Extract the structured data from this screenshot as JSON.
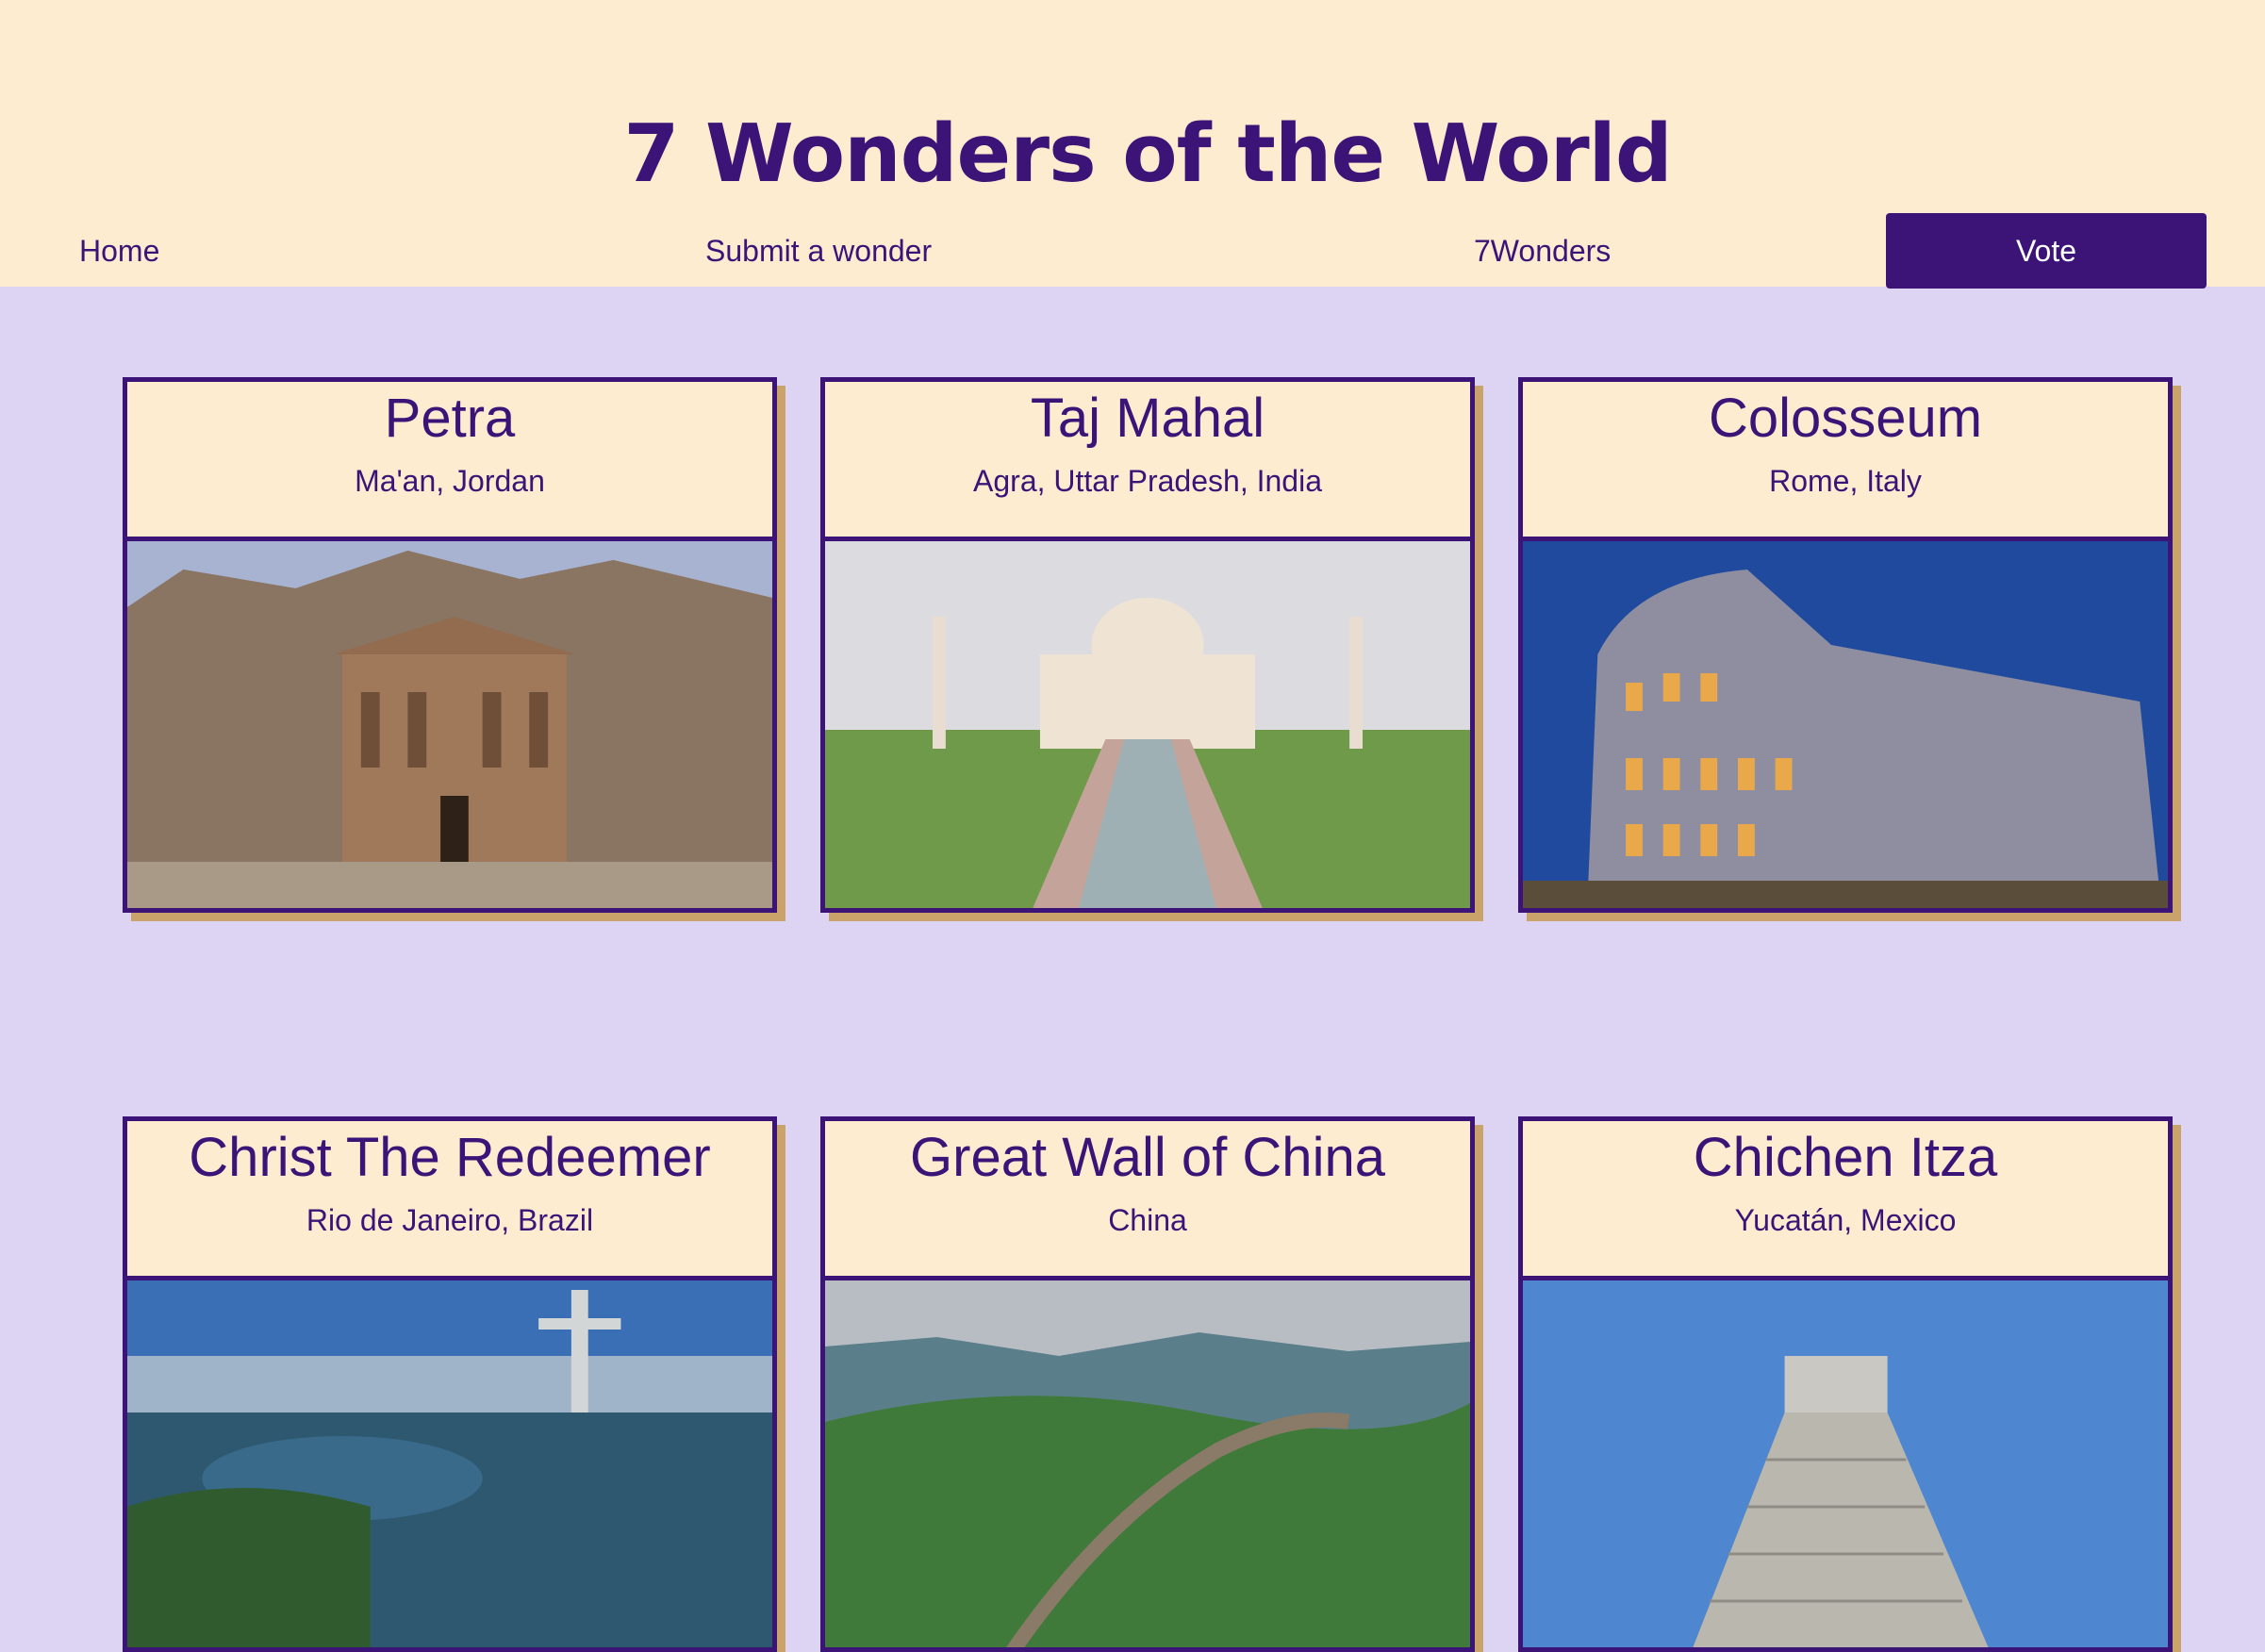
{
  "site": {
    "title": "7 Wonders of the World"
  },
  "nav": {
    "home": "Home",
    "submit": "Submit a wonder",
    "wonders": "7Wonders",
    "vote": "Vote"
  },
  "cards": [
    {
      "name": "Petra",
      "location": "Ma'an, Jordan"
    },
    {
      "name": "Taj Mahal",
      "location": "Agra, Uttar Pradesh, India"
    },
    {
      "name": "Colosseum",
      "location": "Rome, Italy"
    },
    {
      "name": "Christ The Redeemer",
      "location": "Rio de Janeiro, Brazil"
    },
    {
      "name": "Great Wall of China",
      "location": "China"
    },
    {
      "name": "Chichen Itza",
      "location": "Yucatán, Mexico"
    }
  ],
  "colors": {
    "primary": "#3c1478",
    "header_bg": "#feecd1",
    "page_bg": "#ddd3f3",
    "card_shadow": "#c9a36a"
  }
}
